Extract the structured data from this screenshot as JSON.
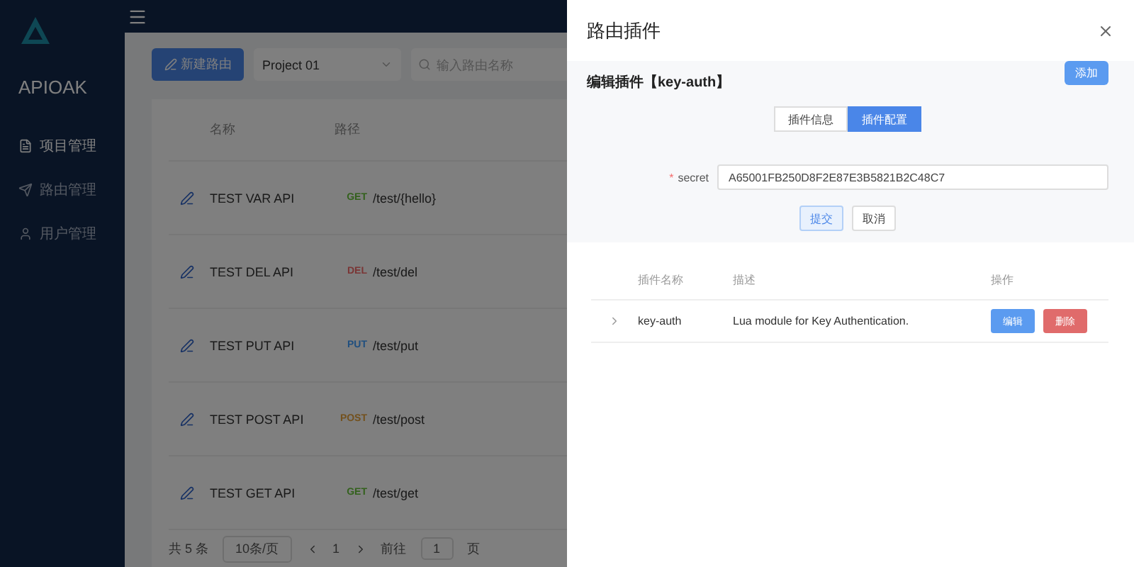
{
  "sidebar": {
    "logo_text": "APIOAK",
    "items": [
      {
        "label": "项目管理",
        "selected": true
      },
      {
        "label": "路由管理",
        "selected": false
      },
      {
        "label": "用户管理",
        "selected": false
      }
    ]
  },
  "toolbar": {
    "new_button": "新建路由",
    "project_select": "Project 01",
    "search": {
      "placeholder": "输入路由名称"
    }
  },
  "table": {
    "columns": [
      "名称",
      "路径"
    ],
    "rows": [
      {
        "name": "TEST VAR API",
        "method": "GET",
        "kind": "get",
        "path": "/test/{hello}"
      },
      {
        "name": "TEST DEL API",
        "method": "DEL",
        "kind": "delete",
        "path": "/test/del"
      },
      {
        "name": "TEST PUT API",
        "method": "PUT",
        "kind": "put",
        "path": "/test/put"
      },
      {
        "name": "TEST POST API",
        "method": "POST",
        "kind": "post",
        "path": "/test/post"
      },
      {
        "name": "TEST GET API",
        "method": "GET",
        "kind": "get",
        "path": "/test/get"
      }
    ]
  },
  "pagination": {
    "total": "共 5 条",
    "page_size": "10条/页",
    "current": "1",
    "goto_label": "前往",
    "goto_value": "1",
    "goto_suffix": "页"
  },
  "drawer": {
    "title": "路由插件",
    "heading": "编辑插件【key-auth】",
    "add_button": "添加",
    "tabs": [
      {
        "label": "插件信息",
        "selected": false
      },
      {
        "label": "插件配置",
        "selected": true
      }
    ],
    "field": {
      "required_mark": "*",
      "label": "secret",
      "value": "A65001FB250D8F2E87E3B5821B2C48C7"
    },
    "buttons": [
      {
        "label": "提交",
        "kind": "primary-plain"
      },
      {
        "label": "取消",
        "kind": "default"
      }
    ],
    "plugin_table": {
      "columns": [
        "插件名称",
        "描述",
        "操作"
      ],
      "rows": [
        {
          "expanded": false,
          "name": "key-auth",
          "description": "Lua module for Key Authentication.",
          "actions": [
            {
              "label": "编辑",
              "kind": "edit"
            },
            {
              "label": "删除",
              "kind": "delete"
            }
          ]
        }
      ]
    }
  }
}
